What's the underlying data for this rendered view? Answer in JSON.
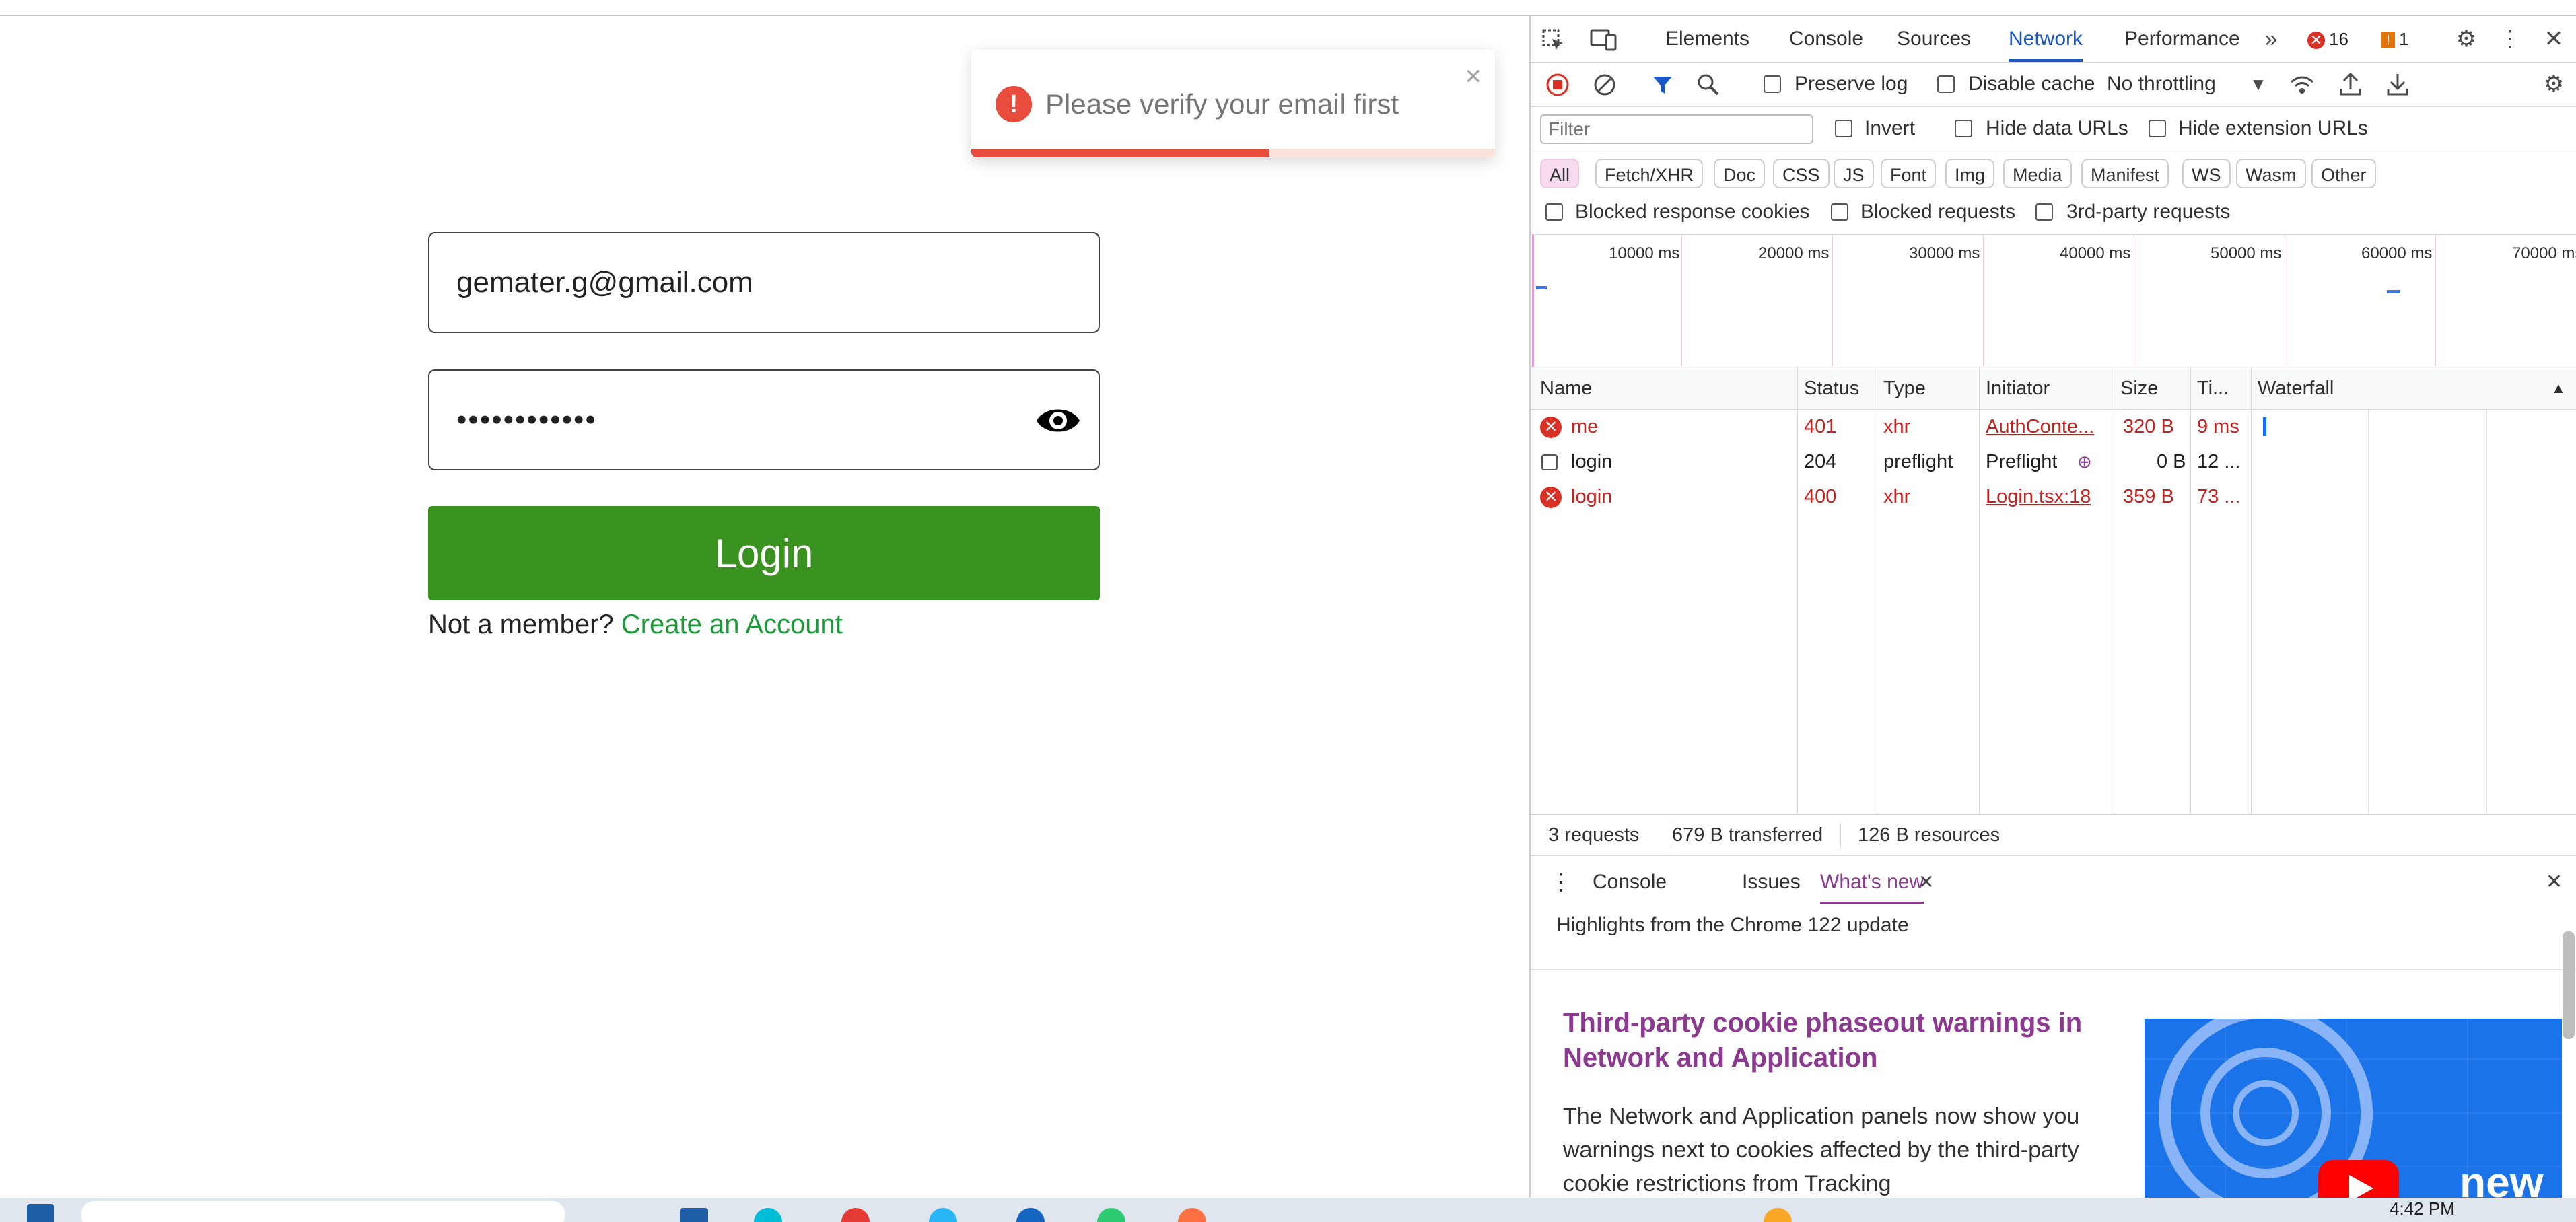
{
  "toast": {
    "icon": "!",
    "message": "Please verify your email first",
    "close": "×",
    "progress": 0.57,
    "color": "#e74c3c"
  },
  "login_form": {
    "email_value": "gemater.g@gmail.com",
    "password_value": "••••••••••••",
    "login_label": "Login",
    "not_member": "Not a member?",
    "create_account": "Create an Account",
    "button_color": "#3a9320",
    "link_color": "#1d9a3a"
  },
  "devtools": {
    "tabs": [
      "Elements",
      "Console",
      "Sources",
      "Network",
      "Performance"
    ],
    "active_tab": "Network",
    "more_tabs": "»",
    "error_count": "16",
    "warning_count": "1",
    "toolbar": {
      "preserve_log": "Preserve log",
      "disable_cache": "Disable cache",
      "throttling": "No throttling"
    },
    "filter_placeholder": "Filter",
    "filter_options": {
      "invert": "Invert",
      "hide_data_urls": "Hide data URLs",
      "hide_extension_urls": "Hide extension URLs"
    },
    "type_filters": [
      "All",
      "Fetch/XHR",
      "Doc",
      "CSS",
      "JS",
      "Font",
      "Img",
      "Media",
      "Manifest",
      "WS",
      "Wasm",
      "Other"
    ],
    "active_type_filter": "All",
    "blocked": {
      "response_cookies": "Blocked response cookies",
      "requests": "Blocked requests",
      "third_party": "3rd-party requests"
    },
    "overview_ticks": [
      "10000 ms",
      "20000 ms",
      "30000 ms",
      "40000 ms",
      "50000 ms",
      "60000 ms",
      "70000 ms"
    ],
    "columns": [
      "Name",
      "Status",
      "Type",
      "Initiator",
      "Size",
      "Ti...",
      "Waterfall"
    ],
    "requests": [
      {
        "name": "me",
        "status": "401",
        "type": "xhr",
        "initiator": "AuthConte...",
        "size": "320 B",
        "time": "9 ms",
        "error": true
      },
      {
        "name": "login",
        "status": "204",
        "type": "preflight",
        "initiator": "Preflight",
        "size": "0 B",
        "time": "12 ...",
        "error": false
      },
      {
        "name": "login",
        "status": "400",
        "type": "xhr",
        "initiator": "Login.tsx:18",
        "size": "359 B",
        "time": "73 ...",
        "error": true
      }
    ],
    "summary": {
      "requests": "3 requests",
      "transferred": "679 B transferred",
      "resources": "126 B resources"
    },
    "drawer": {
      "tabs": [
        "Console",
        "Issues",
        "What's new"
      ],
      "active_tab": "What's new",
      "highlights": "Highlights from the Chrome 122 update",
      "article_title": "Third-party cookie phaseout warnings in Network and Application",
      "article_body": "The Network and Application panels now show you warnings next to cookies affected by the third-party cookie restrictions from Tracking",
      "image_label": "new"
    }
  },
  "taskbar": {
    "clock": "4:42 PM"
  }
}
